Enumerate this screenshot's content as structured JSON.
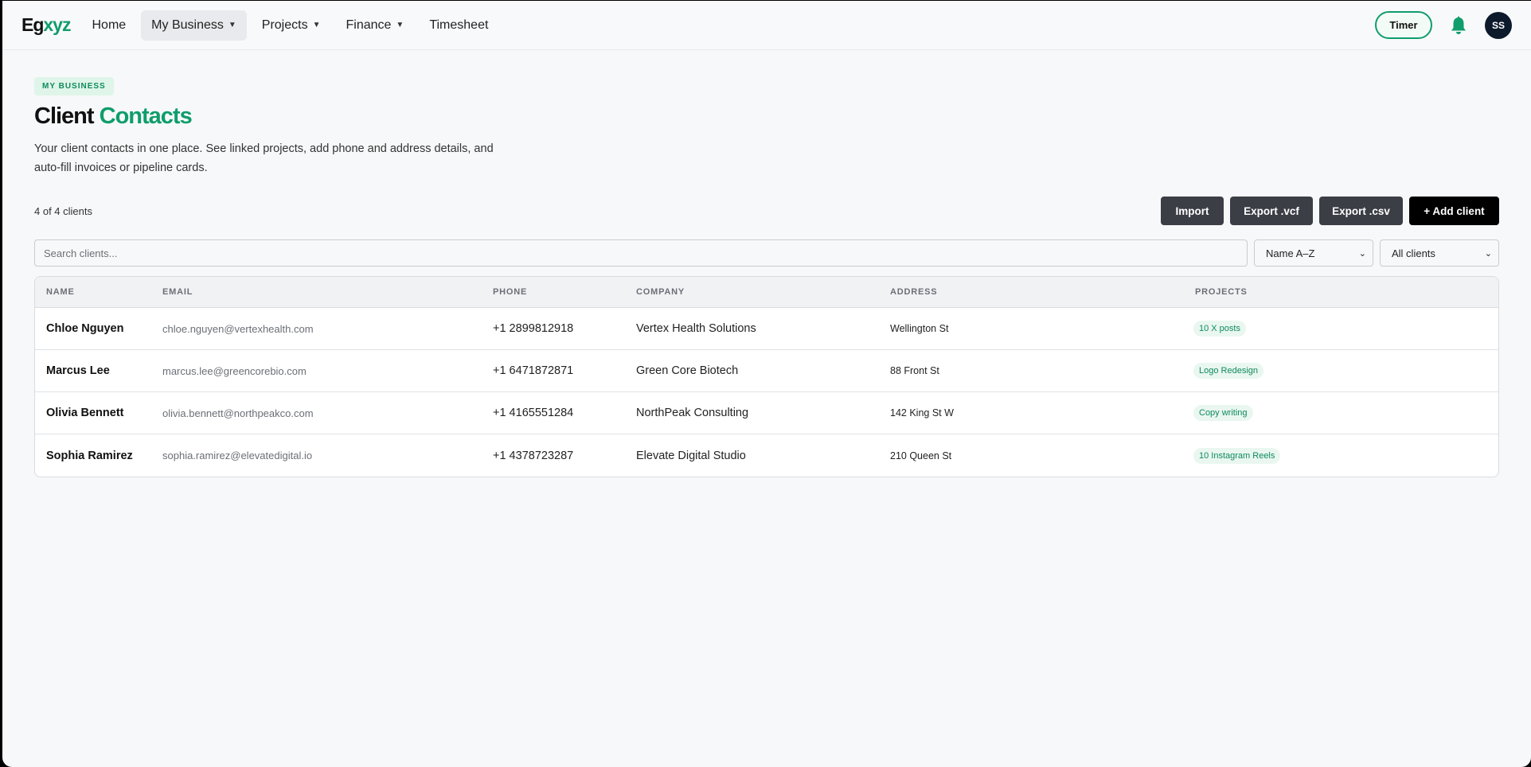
{
  "nav": {
    "logo_part1": "Eg",
    "logo_part2": "xyz",
    "items": [
      {
        "label": "Home",
        "dropdown": false
      },
      {
        "label": "My Business",
        "dropdown": true
      },
      {
        "label": "Projects",
        "dropdown": true
      },
      {
        "label": "Finance",
        "dropdown": true
      },
      {
        "label": "Timesheet",
        "dropdown": false
      }
    ],
    "timer_label": "Timer",
    "avatar_initials": "SS"
  },
  "header": {
    "eyebrow": "MY BUSINESS",
    "title_part1": "Client",
    "title_part2": "Contacts",
    "subtitle": "Your client contacts in one place. See linked projects, add phone and address details, and auto-fill invoices or pipeline cards."
  },
  "toolbar": {
    "count": "4 of 4 clients",
    "import_label": "Import",
    "export_vcf_label": "Export .vcf",
    "export_csv_label": "Export .csv",
    "add_client_label": "+ Add client"
  },
  "filters": {
    "search_placeholder": "Search clients...",
    "sort_value": "Name A–Z",
    "scope_value": "All clients"
  },
  "table": {
    "columns": [
      "NAME",
      "EMAIL",
      "PHONE",
      "COMPANY",
      "ADDRESS",
      "PROJECTS"
    ],
    "rows": [
      {
        "name": "Chloe Nguyen",
        "email": "chloe.nguyen@vertexhealth.com",
        "phone": "+1 2899812918",
        "company": "Vertex Health Solutions",
        "address": "Wellington St",
        "project": "10 X posts"
      },
      {
        "name": "Marcus Lee",
        "email": "marcus.lee@greencorebio.com",
        "phone": "+1 6471872871",
        "company": "Green Core Biotech",
        "address": "88 Front St",
        "project": "Logo Redesign"
      },
      {
        "name": "Olivia Bennett",
        "email": "olivia.bennett@northpeakco.com",
        "phone": "+1 4165551284",
        "company": "NorthPeak Consulting",
        "address": "142 King St W",
        "project": "Copy writing"
      },
      {
        "name": "Sophia Ramirez",
        "email": "sophia.ramirez@elevatedigital.io",
        "phone": "+1 4378723287",
        "company": "Elevate Digital Studio",
        "address": "210 Queen St",
        "project": "10 Instagram Reels"
      }
    ]
  },
  "colors": {
    "brand_green": "#0f9d6b",
    "button_dark": "#3b3e45",
    "button_primary": "#000000",
    "avatar_bg": "#0d1a2b"
  },
  "icons": {
    "bell": "bell-icon",
    "caret": "caret-down-icon"
  }
}
